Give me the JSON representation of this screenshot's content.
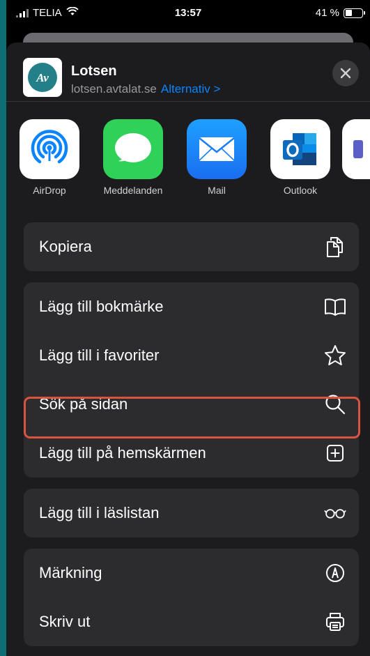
{
  "status_bar": {
    "carrier": "TELIA",
    "time": "13:57",
    "battery_percent": "41 %",
    "battery_level": 0.41
  },
  "share_header": {
    "app_name": "Lotsen",
    "url": "lotsen.avtalat.se",
    "options_label": "Alternativ >",
    "app_icon": "avtalat-logo"
  },
  "share_apps": [
    {
      "label": "AirDrop",
      "icon": "airdrop-icon",
      "color": "#0a84ff"
    },
    {
      "label": "Meddelanden",
      "icon": "messages-icon",
      "color": "#30d158"
    },
    {
      "label": "Mail",
      "icon": "mail-icon",
      "color": "#1e88f5"
    },
    {
      "label": "Outlook",
      "icon": "outlook-icon",
      "color": "#0f6cbd"
    }
  ],
  "actions": {
    "copy": "Kopiera",
    "add_bookmark": "Lägg till bokmärke",
    "add_favorite": "Lägg till i favoriter",
    "find_on_page": "Sök på sidan",
    "add_home_screen": "Lägg till på hemskärmen",
    "add_reading_list": "Lägg till i läslistan",
    "markup": "Märkning",
    "print": "Skriv ut"
  },
  "colors": {
    "background": "#000000",
    "sheet": "#1c1c1e",
    "row_group": "#2c2c2e",
    "link": "#0a84ff",
    "highlight": "#d9533f",
    "frame": "#0c6f75"
  }
}
